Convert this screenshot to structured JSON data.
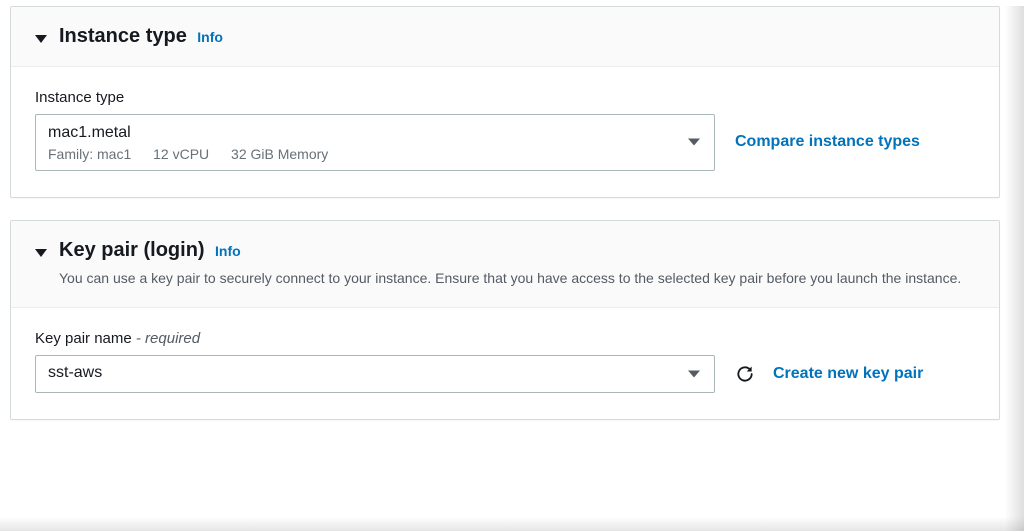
{
  "instanceType": {
    "title": "Instance type",
    "info": "Info",
    "fieldLabel": "Instance type",
    "selected": {
      "name": "mac1.metal",
      "family": "Family: mac1",
      "vcpu": "12 vCPU",
      "memory": "32 GiB Memory"
    },
    "compareLink": "Compare instance types"
  },
  "keyPair": {
    "title": "Key pair (login)",
    "info": "Info",
    "description": "You can use a key pair to securely connect to your instance. Ensure that you have access to the selected key pair before you launch the instance.",
    "fieldLabel": "Key pair name",
    "requiredSuffix": " - required",
    "selectedName": "sst-aws",
    "createLink": "Create new key pair"
  }
}
